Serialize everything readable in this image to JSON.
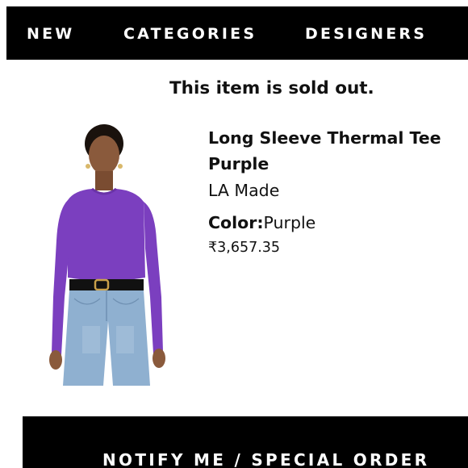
{
  "nav": {
    "items": [
      {
        "label": "NEW"
      },
      {
        "label": "CATEGORIES"
      },
      {
        "label": "DESIGNERS"
      }
    ]
  },
  "status": {
    "message": "This item is sold out."
  },
  "product": {
    "title_line1": "Long Sleeve Thermal Tee",
    "title_line2": "Purple",
    "brand": "LA Made",
    "color_label": "Color:",
    "color_value": "Purple",
    "price": "₹3,657.35",
    "image": {
      "shirt_color": "#7b3fbf",
      "denim_color": "#8fb0d0",
      "skin_color": "#8a5a3c",
      "hair_color": "#1a120d"
    }
  },
  "cta": {
    "label": "NOTIFY ME / SPECIAL ORDER"
  }
}
